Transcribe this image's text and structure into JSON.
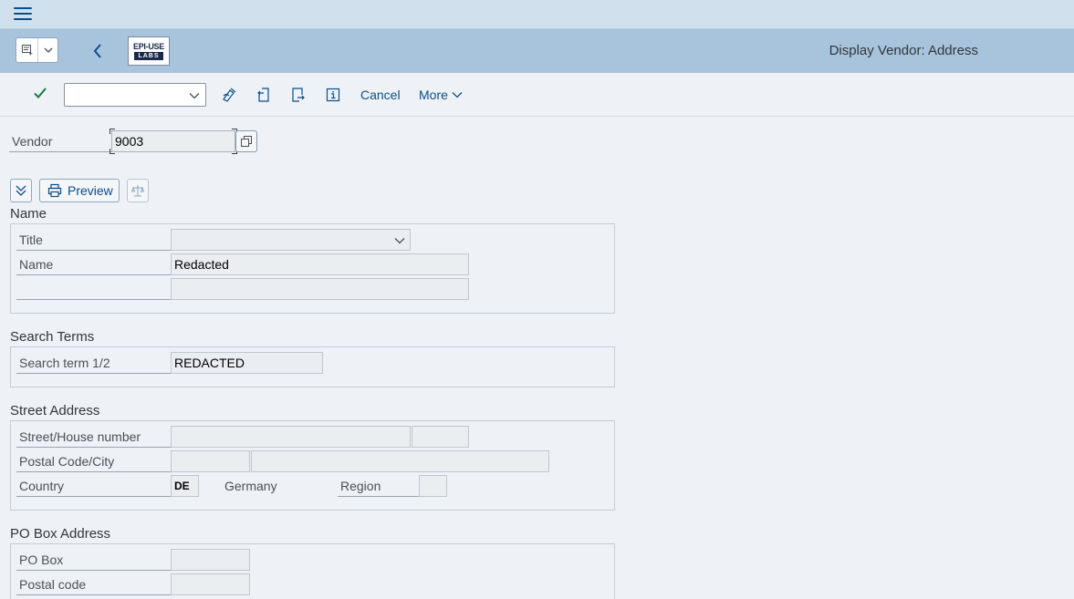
{
  "shell": {
    "menu_icon": "hamburger-icon"
  },
  "header": {
    "title": "Display Vendor: Address",
    "logo_line1": "EPI-USE",
    "logo_line2": "LABS"
  },
  "toolbar": {
    "command_value": "",
    "cancel_label": "Cancel",
    "more_label": "More",
    "icons": [
      "checkmark-icon",
      "other-vendor-icon",
      "previous-entry-icon",
      "next-entry-icon",
      "info-icon"
    ]
  },
  "vendor": {
    "label": "Vendor",
    "value": "9003"
  },
  "actions": {
    "preview_label": "Preview"
  },
  "name_group": {
    "title": "Name",
    "title_label": "Title",
    "title_value": "",
    "name_label": "Name",
    "name_value": "Redacted",
    "name2_value": ""
  },
  "search_group": {
    "title": "Search Terms",
    "label": "Search term 1/2",
    "value": "REDACTED"
  },
  "street_group": {
    "title": "Street Address",
    "street_label": "Street/House number",
    "street_value": "",
    "house_value": "",
    "postal_label": "Postal Code/City",
    "postal_value": "",
    "city_value": "",
    "country_label": "Country",
    "country_value": "DE",
    "country_name": "Germany",
    "region_label": "Region",
    "region_value": ""
  },
  "pobox_group": {
    "title": "PO Box Address",
    "pobox_label": "PO Box",
    "pobox_value": "",
    "postal_label": "Postal code",
    "postal_value": ""
  },
  "colors": {
    "accent": "#0a4e8c",
    "header_bg": "#a8c3dc",
    "shell_bg": "#d1e0ed",
    "check_green": "#107e3e"
  }
}
